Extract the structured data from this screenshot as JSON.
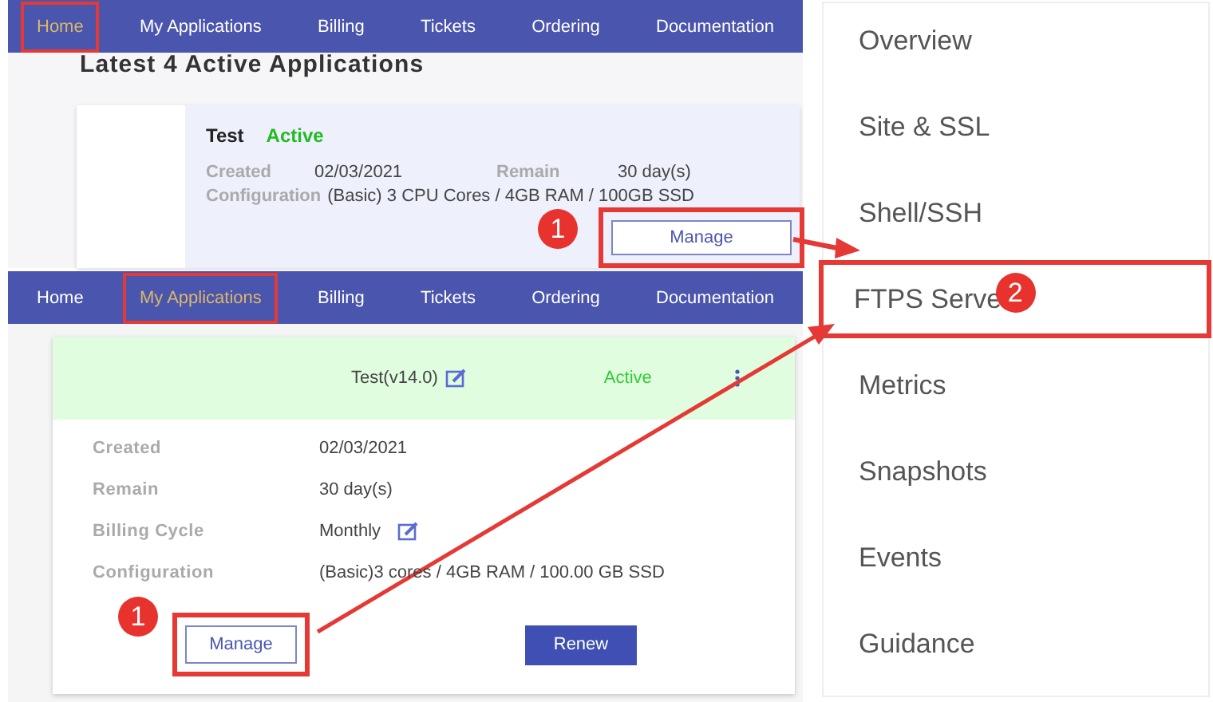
{
  "home_panel": {
    "nav": [
      {
        "label": "Home",
        "selected": true,
        "highlighted": true
      },
      {
        "label": "My Applications",
        "selected": false,
        "highlighted": false
      },
      {
        "label": "Billing",
        "selected": false,
        "highlighted": false
      },
      {
        "label": "Tickets",
        "selected": false,
        "highlighted": false
      },
      {
        "label": "Ordering",
        "selected": false,
        "highlighted": false
      },
      {
        "label": "Documentation",
        "selected": false,
        "highlighted": false
      }
    ],
    "heading": "Latest 4 Active Applications",
    "card": {
      "name": "Test",
      "status": "Active",
      "rows": [
        {
          "fields": [
            {
              "label": "Created",
              "value": "02/03/2021"
            },
            {
              "label": "Remain",
              "value": "30 day(s)"
            }
          ]
        },
        {
          "fields": [
            {
              "label": "Configuration",
              "value": "(Basic) 3 CPU Cores / 4GB RAM / 100GB SSD"
            }
          ]
        }
      ],
      "manage_button": {
        "label": "Manage",
        "highlighted": true,
        "badge": "1"
      }
    }
  },
  "applications_panel": {
    "nav": [
      {
        "label": "Home",
        "selected": false,
        "highlighted": false
      },
      {
        "label": "My Applications",
        "selected": true,
        "highlighted": true
      },
      {
        "label": "Billing",
        "selected": false,
        "highlighted": false
      },
      {
        "label": "Tickets",
        "selected": false,
        "highlighted": false
      },
      {
        "label": "Ordering",
        "selected": false,
        "highlighted": false
      },
      {
        "label": "Documentation",
        "selected": false,
        "highlighted": false
      }
    ],
    "card": {
      "title": "Test(v14.0)",
      "status": "Active",
      "fields": [
        {
          "label": "Created",
          "value": "02/03/2021",
          "editable": false
        },
        {
          "label": "Remain",
          "value": "30 day(s)",
          "editable": false
        },
        {
          "label": "Billing Cycle",
          "value": "Monthly",
          "editable": true
        },
        {
          "label": "Configuration",
          "value": "(Basic)3 cores / 4GB RAM / 100.00 GB SSD",
          "editable": false
        }
      ],
      "manage_button": {
        "label": "Manage",
        "highlighted": true,
        "badge": "1"
      },
      "renew_button": {
        "label": "Renew"
      }
    }
  },
  "menu_panel": {
    "items": [
      {
        "label": "Overview",
        "highlighted": false
      },
      {
        "label": "Site & SSL",
        "highlighted": false
      },
      {
        "label": "Shell/SSH",
        "highlighted": false
      },
      {
        "label": "FTPS Serve",
        "highlighted": true,
        "badge": "2"
      },
      {
        "label": "Metrics",
        "highlighted": false
      },
      {
        "label": "Snapshots",
        "highlighted": false
      },
      {
        "label": "Events",
        "highlighted": false
      },
      {
        "label": "Guidance",
        "highlighted": false
      }
    ]
  }
}
